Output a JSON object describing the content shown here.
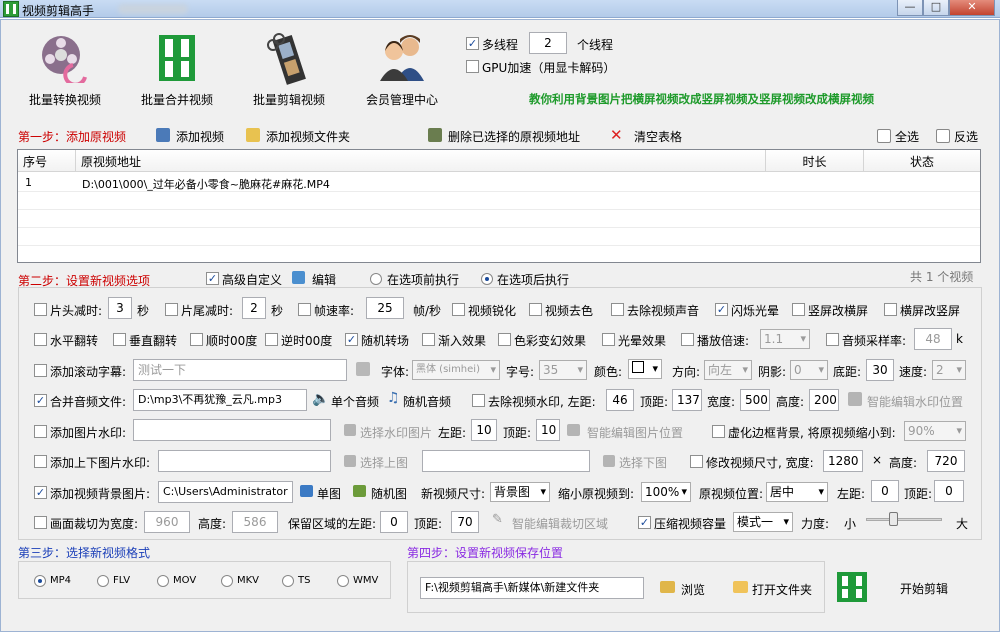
{
  "window": {
    "title": "视频剪辑高手",
    "minimize": "—",
    "maximize": "□",
    "close": "✕"
  },
  "toolbar": [
    {
      "label": "批量转换视频",
      "icon": "film-reel-icon"
    },
    {
      "label": "批量合并视频",
      "icon": "film-strip-green-icon"
    },
    {
      "label": "批量剪辑视频",
      "icon": "film-scissors-icon"
    },
    {
      "label": "会员管理中心",
      "icon": "users-icon"
    }
  ],
  "threads": {
    "label": "多线程",
    "value": "2",
    "unit": "个线程",
    "checked": true
  },
  "gpu": {
    "label": "GPU加速（用显卡解码）",
    "checked": false
  },
  "promo": "教你利用背景图片把横屏视频改成竖屏视频及竖屏视频改成横屏视频",
  "step1": {
    "title": "第一步：添加原视频",
    "add_video": "添加视频",
    "add_folder": "添加视频文件夹",
    "delete_selected": "删除已选择的原视频地址",
    "clear_table": "清空表格",
    "select_all": "全选",
    "invert": "反选"
  },
  "table": {
    "headers": [
      "序号",
      "原视频地址",
      "时长",
      "状态"
    ],
    "rows": [
      [
        "1",
        "D:\\001\\000\\_过年必备小零食~脆麻花#麻花.MP4",
        "",
        ""
      ]
    ]
  },
  "step2": {
    "title": "第二步：设置新视频选项",
    "advanced": "高级自定义",
    "edit": "编辑",
    "before": "在选项前执行",
    "after": "在选项后执行",
    "count": "共 1 个视频"
  },
  "row1": {
    "head_cut": "片头减时:",
    "head_val": "3",
    "sec1": "秒",
    "tail_cut": "片尾减时:",
    "tail_val": "2",
    "sec2": "秒",
    "fps": "帧速率:",
    "fps_val": "25",
    "fps_unit": "帧/秒",
    "sharpen": "视频锐化",
    "decolor": "视频去色",
    "mute": "去除视频声音",
    "flash": "闪烁光晕",
    "h2v": "竖屏改横屏",
    "v2h": "横屏改竖屏"
  },
  "row2": {
    "hflip": "水平翻转",
    "vflip": "垂直翻转",
    "cw": "顺时00度",
    "ccw": "逆时00度",
    "random": "随机转场",
    "fadein": "渐入效果",
    "color": "色彩变幻效果",
    "halo": "光晕效果",
    "speed": "播放倍速:",
    "speed_val": "1.1",
    "sample": "音频采样率:",
    "sample_val": "48",
    "sample_unit": "k"
  },
  "row3": {
    "scroll": "添加滚动字幕:",
    "scroll_val": "测试一下",
    "font_lbl": "字体:",
    "font_val": "黑体 (simhei)",
    "size_lbl": "字号:",
    "size_val": "35",
    "color_lbl": "颜色:",
    "dir_lbl": "方向:",
    "dir_val": "向左",
    "shadow_lbl": "阴影:",
    "shadow_val": "0",
    "bottom_lbl": "底距:",
    "bottom_val": "30",
    "speed_lbl": "速度:",
    "speed_val": "2"
  },
  "row4": {
    "merge_audio": "合并音频文件:",
    "audio_val": "D:\\mp3\\不再犹豫_云凡.mp3",
    "single": "单个音频",
    "random": "随机音频",
    "remove_wm": "去除视频水印, 左距:",
    "left_val": "46",
    "top_lbl": "顶距:",
    "top_val": "137",
    "width_lbl": "宽度:",
    "width_val": "500",
    "height_lbl": "高度:",
    "height_val": "200",
    "smart_wm": "智能编辑水印位置"
  },
  "row5": {
    "img_wm": "添加图片水印:",
    "choose": "选择水印图片",
    "left_lbl": "左距:",
    "left_val": "10",
    "top_lbl": "顶距:",
    "top_val": "10",
    "smart": "智能编辑图片位置",
    "blur_bg": "虚化边框背景, 将原视频缩小到:",
    "blur_val": "90%"
  },
  "row6": {
    "tb_img": "添加上下图片水印:",
    "upper": "选择上图",
    "lower": "选择下图",
    "resize": "修改视频尺寸, 宽度:",
    "width_val": "1280",
    "x": "×",
    "height_lbl": "高度:",
    "height_val": "720"
  },
  "row7": {
    "bg_img": "添加视频背景图片:",
    "bg_val": "C:\\Users\\Administrator",
    "single": "单图",
    "random": "随机图",
    "size_lbl": "新视频尺寸:",
    "size_val": "背景图",
    "shrink_lbl": "缩小原视频到:",
    "shrink_val": "100%",
    "pos_lbl": "原视频位置:",
    "pos_val": "居中",
    "left_lbl": "左距:",
    "left_val": "0",
    "top_lbl": "顶距:",
    "top_val": "0"
  },
  "row8": {
    "crop": "画面裁切为宽度:",
    "w_val": "960",
    "h_lbl": "高度:",
    "h_val": "586",
    "keep": "保留区域的左距:",
    "left_val": "0",
    "top_lbl": "顶距:",
    "top_val": "70",
    "smart_crop": "智能编辑裁切区域",
    "compress": "压缩视频容量",
    "mode_val": "模式一",
    "force": "力度:",
    "small": "小",
    "big": "大"
  },
  "step3": {
    "title": "第三步：选择新视频格式",
    "formats": [
      "MP4",
      "FLV",
      "MOV",
      "MKV",
      "TS",
      "WMV"
    ]
  },
  "step4": {
    "title": "第四步：设置新视频保存位置",
    "path": "F:\\视频剪辑高手\\新媒体\\新建文件夹",
    "browse": "浏览",
    "open_folder": "打开文件夹",
    "start": "开始剪辑"
  }
}
